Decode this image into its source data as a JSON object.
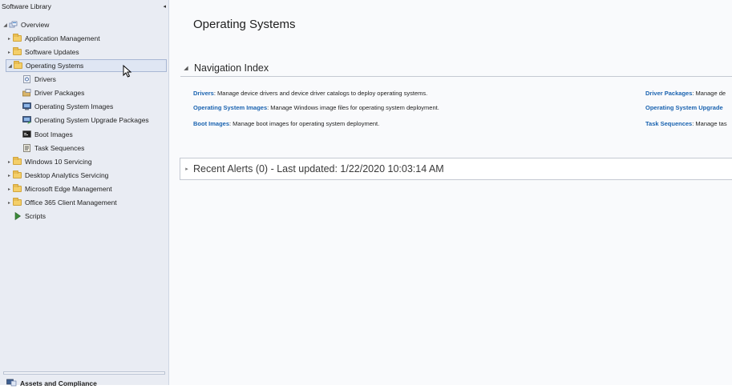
{
  "sidebar": {
    "title": "Software Library",
    "collapse_icon": "chevron-left-icon",
    "tree": [
      {
        "label": "Overview",
        "icon": "overview-icon",
        "expander": "expanded"
      },
      {
        "label": "Application Management",
        "icon": "folder-icon",
        "expander": "collapsed"
      },
      {
        "label": "Software Updates",
        "icon": "folder-icon",
        "expander": "collapsed"
      },
      {
        "label": "Operating Systems",
        "icon": "folder-icon",
        "expander": "expanded",
        "selected": true
      },
      {
        "label": "Drivers",
        "icon": "driver-icon"
      },
      {
        "label": "Driver Packages",
        "icon": "driver-package-icon"
      },
      {
        "label": "Operating System Images",
        "icon": "os-image-icon"
      },
      {
        "label": "Operating System Upgrade Packages",
        "icon": "os-upgrade-package-icon"
      },
      {
        "label": "Boot Images",
        "icon": "boot-image-icon"
      },
      {
        "label": "Task Sequences",
        "icon": "task-sequence-icon"
      },
      {
        "label": "Windows 10 Servicing",
        "icon": "folder-icon",
        "expander": "collapsed"
      },
      {
        "label": "Desktop Analytics Servicing",
        "icon": "folder-icon",
        "expander": "collapsed"
      },
      {
        "label": "Microsoft Edge Management",
        "icon": "folder-icon",
        "expander": "collapsed"
      },
      {
        "label": "Office 365 Client Management",
        "icon": "folder-icon",
        "expander": "collapsed"
      },
      {
        "label": "Scripts",
        "icon": "scripts-icon"
      }
    ],
    "workspace": {
      "label": "Assets and Compliance",
      "icon": "assets-compliance-icon"
    }
  },
  "main": {
    "title": "Operating Systems",
    "navigation_index": {
      "title": "Navigation Index",
      "left": [
        {
          "link": "Drivers",
          "text": ": Manage device drivers and device driver catalogs to deploy operating systems."
        },
        {
          "link": "Operating System Images",
          "text": ": Manage Windows image files for operating system deployment."
        },
        {
          "link": "Boot Images",
          "text": ": Manage boot images for operating system deployment."
        }
      ],
      "right": [
        {
          "link": "Driver Packages",
          "text": ": Manage de"
        },
        {
          "link": "Operating System Upgrade",
          "text": ""
        },
        {
          "link": "Task Sequences",
          "text": ": Manage tas"
        }
      ]
    },
    "recent_alerts": {
      "title": "Recent Alerts (0) - Last updated: 1/22/2020 10:03:14 AM"
    }
  },
  "colors": {
    "link": "#1a63b0",
    "sidebar_bg": "#e9ecf3",
    "selection": "#dfe6f3"
  }
}
